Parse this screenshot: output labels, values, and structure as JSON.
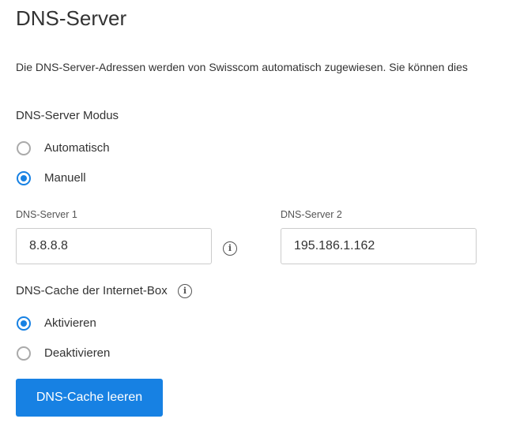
{
  "title": "DNS-Server",
  "description": "Die DNS-Server-Adressen werden von Swisscom automatisch zugewiesen. Sie können dies",
  "mode": {
    "label": "DNS-Server Modus",
    "options": [
      {
        "label": "Automatisch",
        "selected": false
      },
      {
        "label": "Manuell",
        "selected": true
      }
    ]
  },
  "dns1": {
    "label": "DNS-Server 1",
    "value": "8.8.8.8"
  },
  "dns2": {
    "label": "DNS-Server 2",
    "value": "195.186.1.162"
  },
  "cache": {
    "label": "DNS-Cache der Internet-Box",
    "options": [
      {
        "label": "Aktivieren",
        "selected": true
      },
      {
        "label": "Deaktivieren",
        "selected": false
      }
    ],
    "button": "DNS-Cache leeren"
  },
  "info_glyph": "i",
  "accent": "#1781e3"
}
